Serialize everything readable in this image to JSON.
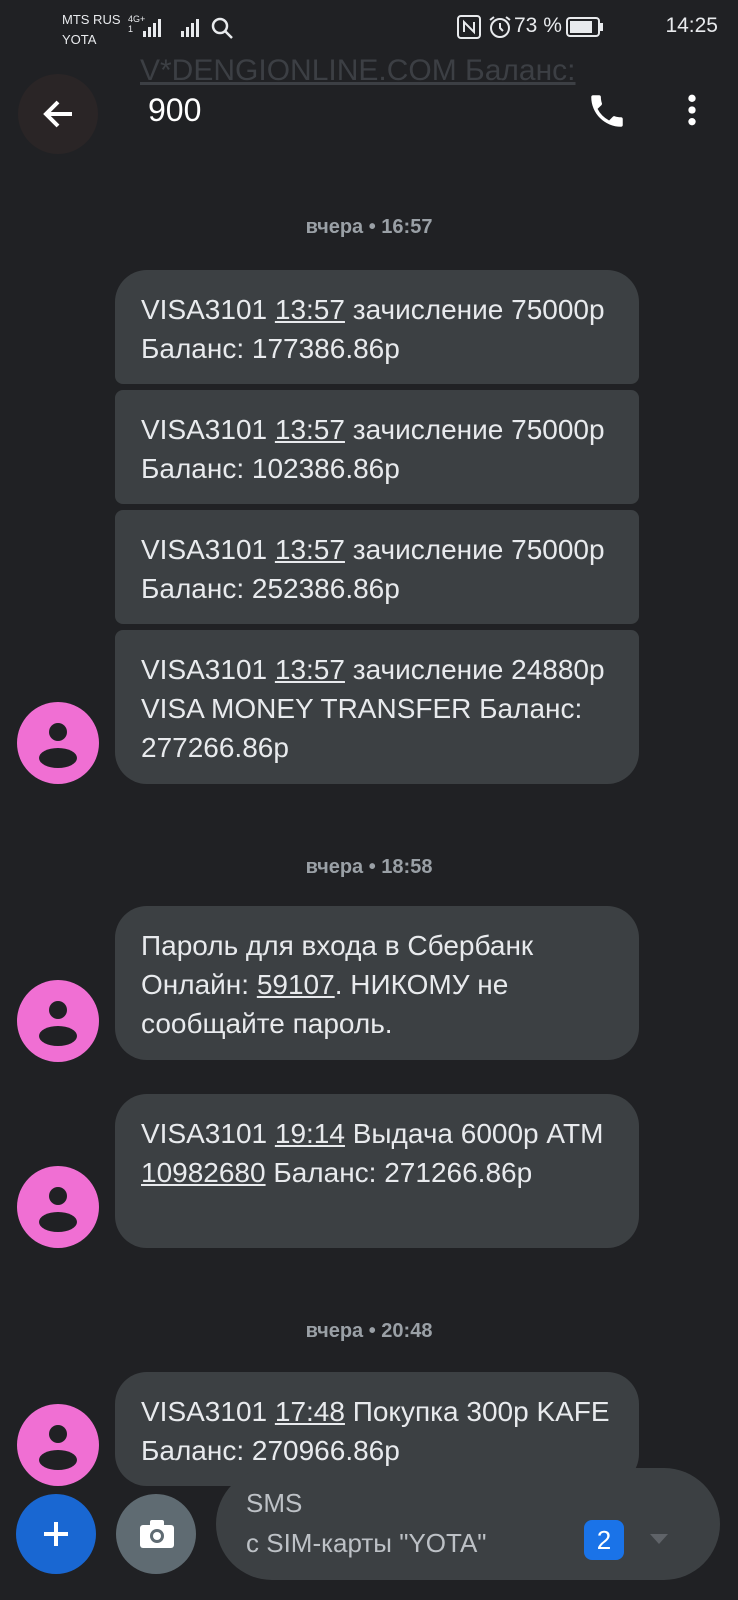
{
  "status_bar": {
    "carrier1": "MTS RUS",
    "carrier2": "YOTA",
    "net1": "4G+",
    "net2": "1",
    "battery_pct": "73 %",
    "time": "14:25",
    "icons": [
      "nfc-icon",
      "alarm-icon",
      "battery-icon",
      "search-icon"
    ]
  },
  "ghost_preview": "V*DENGIONLINE.COM Баланс:",
  "header": {
    "title": "900",
    "icons": [
      "back-arrow-icon",
      "phone-icon",
      "more-vert-icon"
    ]
  },
  "groups": [
    {
      "time_label": "вчера • 16:57",
      "messages": [
        {
          "prefix": "VISA3101 ",
          "link": "13:57",
          "rest": " зачисление 75000р Баланс: 177386.86р"
        },
        {
          "prefix": "VISA3101 ",
          "link": "13:57",
          "rest": " зачисление 75000р Баланс: 102386.86р"
        },
        {
          "prefix": "VISA3101 ",
          "link": "13:57",
          "rest": " зачисление 75000р Баланс: 252386.86р"
        },
        {
          "prefix": "VISA3101 ",
          "link": "13:57",
          "rest": " зачисление 24880р VISA MONEY TRANSFER Баланс: 277266.86р"
        }
      ]
    },
    {
      "time_label": "вчера • 18:58",
      "messages": [
        {
          "prefix": "Пароль для входа в Сбербанк Онлайн: ",
          "link": "59107",
          "rest": ". НИКОМУ не сообщайте пароль."
        },
        {
          "prefix": "VISA3101 ",
          "link": "19:14",
          "rest": " Выдача 6000р ATM ",
          "link2": "10982680",
          "rest2": " Баланс: 271266.86р"
        }
      ]
    },
    {
      "time_label": "вчера • 20:48",
      "messages": [
        {
          "prefix": "VISA3101 ",
          "link": "17:48",
          "rest": " Покупка 300р KAFE Баланс: 270966.86р"
        }
      ]
    }
  ],
  "composer": {
    "line1": "SMS",
    "line2": "с SIM-карты \"YOTA\"",
    "sim_number": "2",
    "icons": [
      "add-icon",
      "camera-icon",
      "dropdown-icon"
    ]
  },
  "colors": {
    "background": "#202124",
    "bubble": "#3c4043",
    "avatar": "#f06fd3",
    "fab": "#1967d2",
    "sim_badge": "#1a73e8"
  }
}
